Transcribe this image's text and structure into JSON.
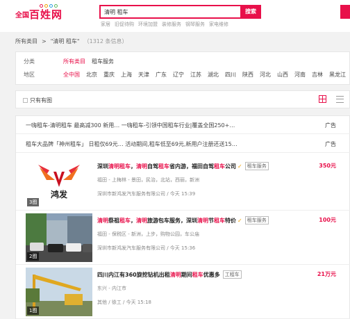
{
  "header": {
    "logo_prefix": "全国",
    "logo_name": "百姓网",
    "search_value": "清明 租车",
    "search_button": "搜索",
    "hot_links": [
      "家居",
      "旧促待购",
      "环境加盟",
      "装修服务",
      "钢琴服务",
      "家电维修"
    ]
  },
  "breadcrumb": {
    "root": "所有类目",
    "sep": ">",
    "query": "\"清明 租车\"",
    "count": "（1312 条信息）"
  },
  "filters": {
    "category_label": "分类",
    "categories": [
      "所有类目",
      "租车服务"
    ],
    "area_label": "地区",
    "areas": [
      "全中国",
      "北京",
      "重庆",
      "上海",
      "天津",
      "广东",
      "辽宁",
      "江苏",
      "湖北",
      "四川",
      "陕西",
      "河北",
      "山西",
      "河南",
      "吉林",
      "黑龙江"
    ]
  },
  "toolbar": {
    "only_images": "只有有图"
  },
  "ads": [
    {
      "text": "一嗨租车-清明租车 最高减300 新用…   一嗨租车-引领中国租车行业|覆盖全国250+…",
      "tag": "广告"
    },
    {
      "text": "租车大品牌「神州租车」 日租仅69元…  活动期间,租车低至69元,新用户注册还送15…",
      "tag": "广告"
    }
  ],
  "listings": [
    {
      "title_parts": [
        [
          "深圳",
          ""
        ],
        [
          "清明租车",
          "hl"
        ],
        [
          "，",
          ""
        ],
        [
          "清明",
          "hl"
        ],
        [
          "自驾",
          ""
        ],
        [
          "租车",
          "hl"
        ],
        [
          "省内游，福田自驾",
          ""
        ],
        [
          "租车",
          "hl"
        ],
        [
          "公司",
          ""
        ]
      ],
      "category": "租车服务",
      "price": "350元",
      "images": "3图",
      "location": "福田 - 上梅林 - 景田，民治，北站，西丽，新洲",
      "meta": "深圳市新鸿发汽车服务有限公司 / 今天 15:39"
    },
    {
      "title_parts": [
        [
          "清明",
          "hl"
        ],
        [
          "祭祖",
          ""
        ],
        [
          "租车",
          "hl"
        ],
        [
          "，",
          ""
        ],
        [
          "清明",
          "hl"
        ],
        [
          "旅游包车服务，深圳",
          ""
        ],
        [
          "清明",
          "hl"
        ],
        [
          "节",
          ""
        ],
        [
          "租车",
          "hl"
        ],
        [
          "特价",
          ""
        ]
      ],
      "category": "租车服务",
      "price": "100元",
      "images": "2图",
      "location": "福田 - 保税区 - 新洲，上步，购物公园，车公庙",
      "meta": "深圳市新鸿发汽车服务有限公司 / 今天 15:36"
    },
    {
      "title_parts": [
        [
          "四川内江有360旋挖钻机出租 ",
          ""
        ],
        [
          "清明",
          "hl"
        ],
        [
          "期间",
          ""
        ],
        [
          "租车",
          "hl"
        ],
        [
          "优惠多",
          ""
        ]
      ],
      "category": "工程车",
      "price": "21万元",
      "images": "1图",
      "location": "东兴 - 内江市",
      "meta": "其他 / 徐工 / 今天 15:18"
    }
  ],
  "colors": {
    "accent": "#e8104a",
    "verified": "#f0a000"
  }
}
